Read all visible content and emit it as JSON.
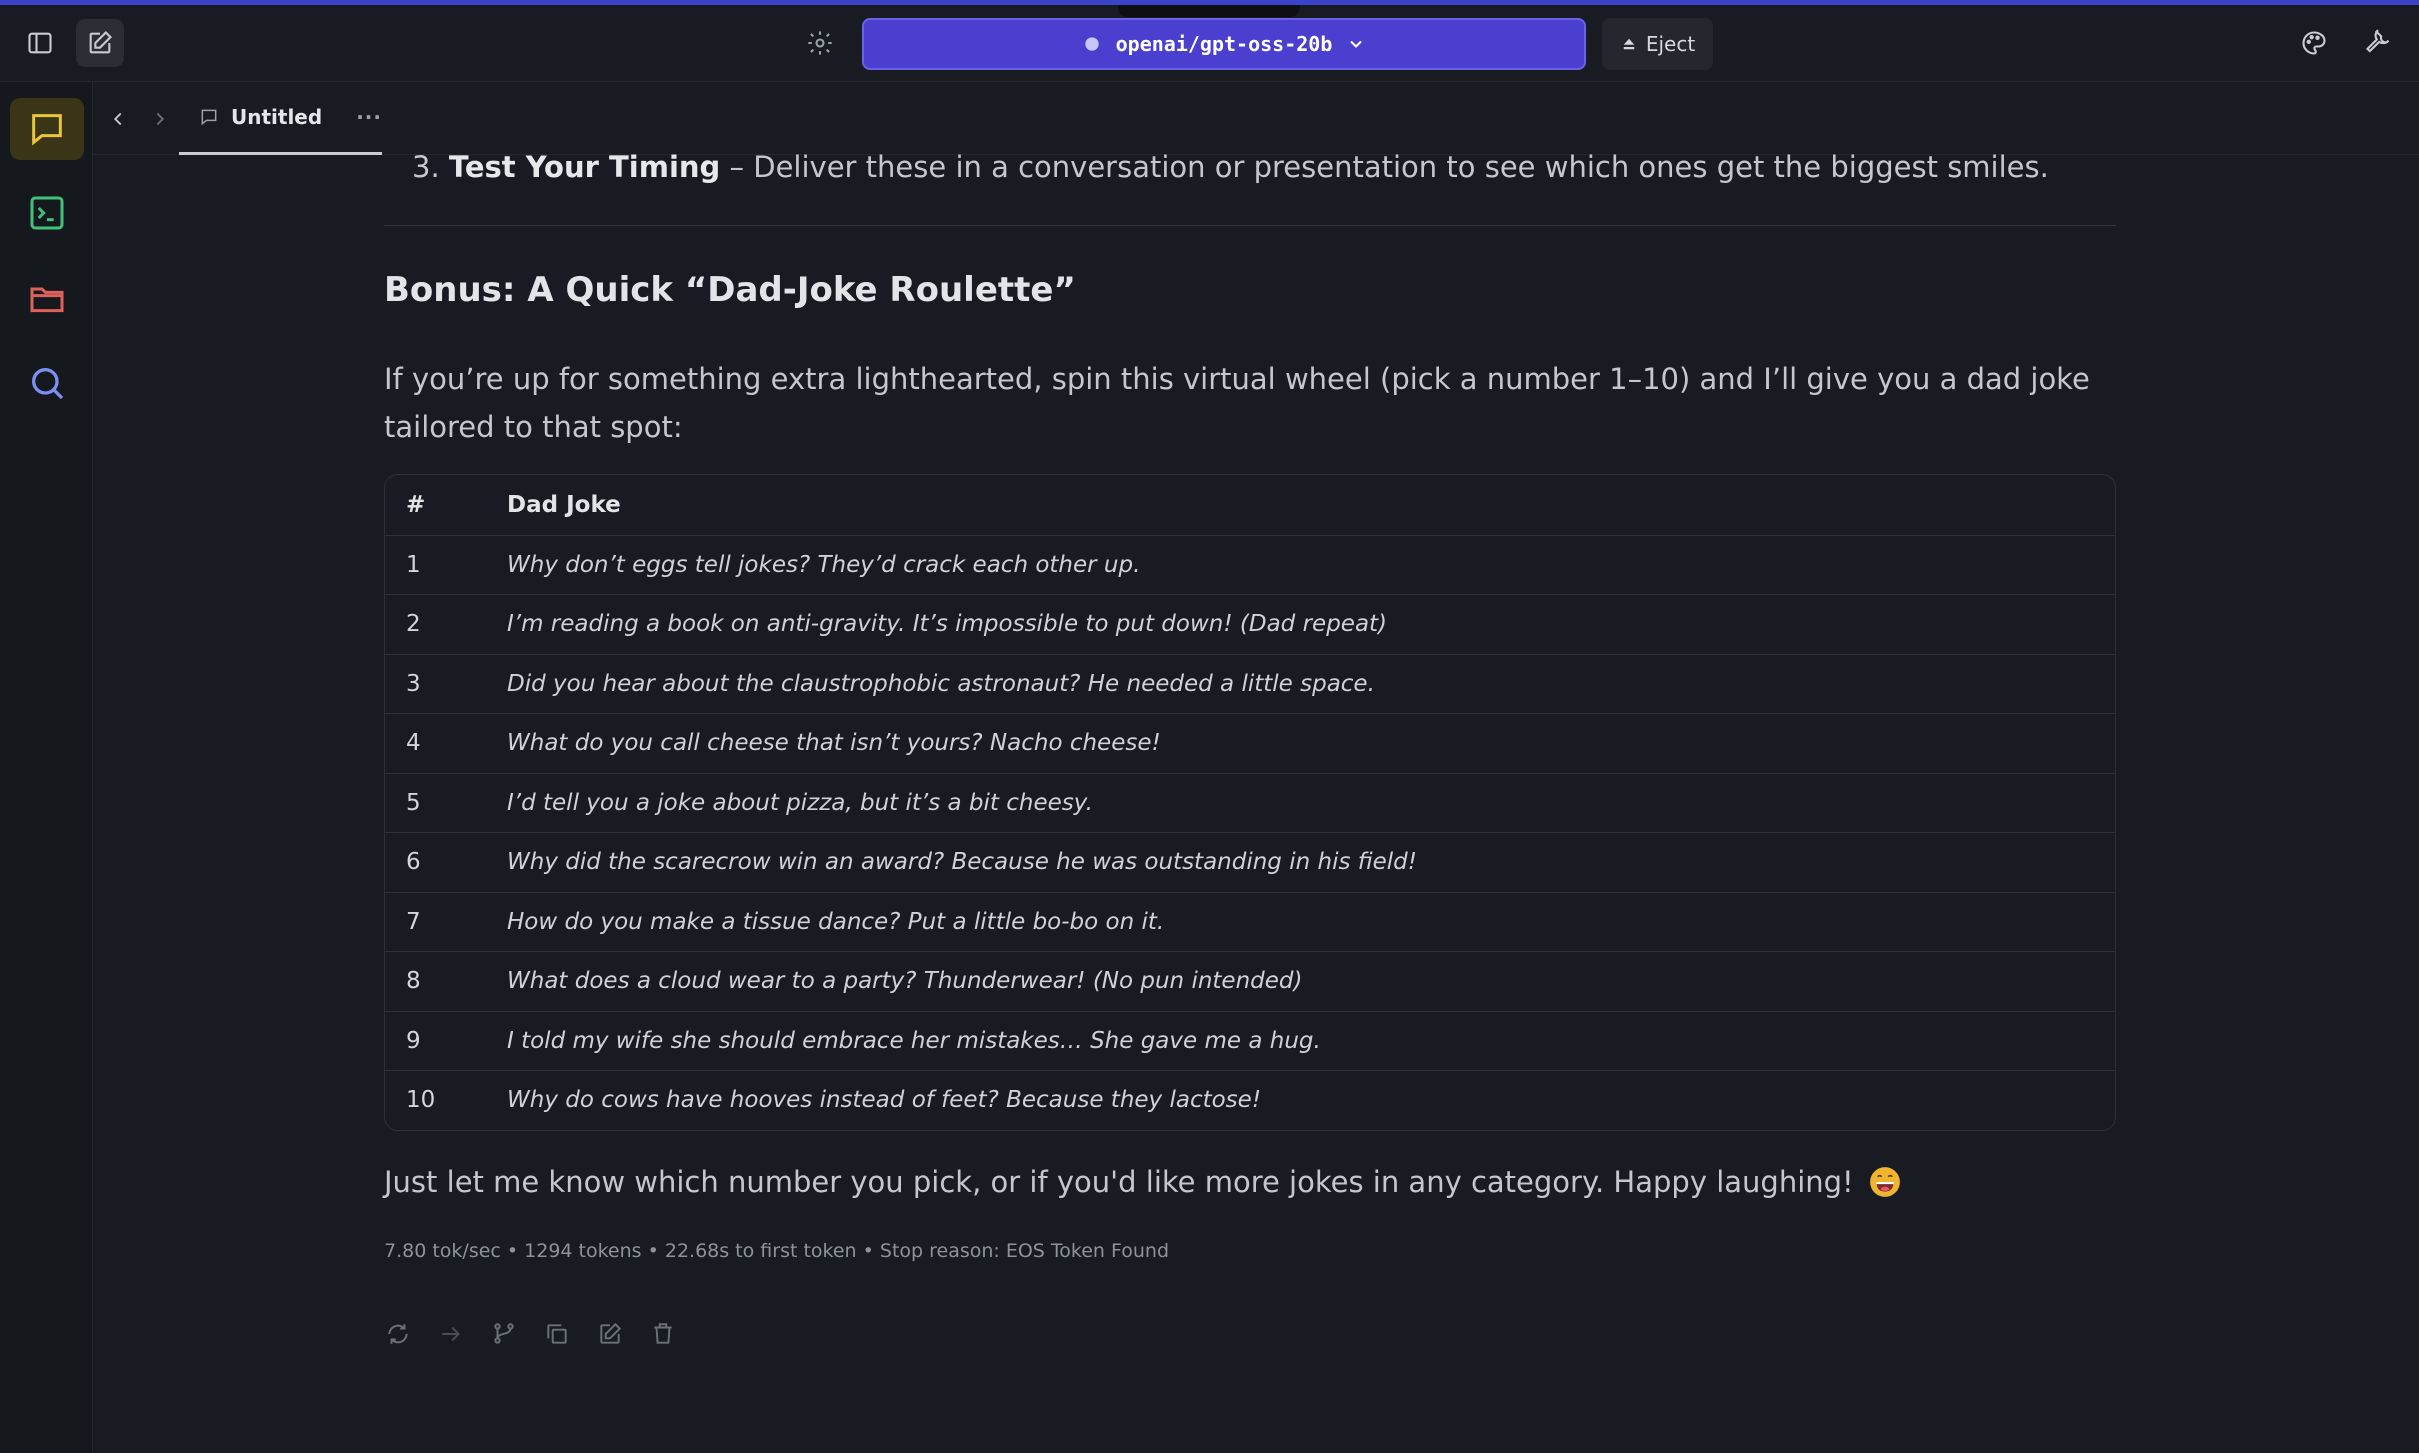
{
  "app": {
    "model_selector": {
      "label": "openai/gpt-oss-20b"
    },
    "eject_label": "Eject"
  },
  "tab": {
    "title": "Untitled",
    "more": "···"
  },
  "message": {
    "step": {
      "number": "3.",
      "bold": "Test Your Timing",
      "text": " – Deliver these in a conversation or presentation to see which ones get the biggest smiles."
    },
    "bonus_title": "Bonus: A Quick “Dad-Joke Roulette”",
    "intro": "If you’re up for something extra lighthearted, spin this virtual wheel (pick a number 1–10) and I’ll give you a dad joke tailored to that spot:",
    "table": {
      "headers": [
        "#",
        "Dad Joke"
      ],
      "rows": [
        {
          "num": "1",
          "joke": "Why don’t eggs tell jokes? They’d crack each other up."
        },
        {
          "num": "2",
          "joke": "I’m reading a book on anti-gravity. It’s impossible to put down! (Dad repeat)"
        },
        {
          "num": "3",
          "joke": "Did you hear about the claustrophobic astronaut? He needed a little space."
        },
        {
          "num": "4",
          "joke": "What do you call cheese that isn’t yours? Nacho cheese!"
        },
        {
          "num": "5",
          "joke": "I’d tell you a joke about pizza, but it’s a bit cheesy."
        },
        {
          "num": "6",
          "joke": "Why did the scarecrow win an award? Because he was outstanding in his field!"
        },
        {
          "num": "7",
          "joke": "How do you make a tissue dance? Put a little bo-bo on it."
        },
        {
          "num": "8",
          "joke": "What does a cloud wear to a party? Thunderwear! (No pun intended)"
        },
        {
          "num": "9",
          "joke": "I told my wife she should embrace her mistakes… She gave me a hug."
        },
        {
          "num": "10",
          "joke": "Why do cows have hooves instead of feet? Because they lactose!"
        }
      ]
    },
    "closing": "Just let me know which number you pick, or if you'd like more jokes in any category. Happy laughing!",
    "stats": "7.80 tok/sec • 1294 tokens • 22.68s to first token • Stop reason: EOS Token Found"
  },
  "colors": {
    "accent": "#4a3fcf",
    "background": "#181b21",
    "rail_active": "#3a3517",
    "chat_icon": "#e8c53a",
    "terminal_icon": "#3fc27a",
    "folder_icon": "#e0605a",
    "search_icon": "#7d8ff0"
  },
  "icons": {
    "top_left": [
      "sidebar-toggle-icon",
      "new-chat-icon"
    ],
    "top_center": [
      "settings-icon"
    ],
    "top_right": [
      "palette-icon",
      "wrench-icon"
    ],
    "rail": [
      "chat-icon",
      "terminal-icon",
      "folder-icon",
      "search-icon"
    ],
    "actions": [
      "regenerate-icon",
      "continue-icon",
      "branch-icon",
      "copy-icon",
      "edit-icon",
      "delete-icon"
    ]
  }
}
